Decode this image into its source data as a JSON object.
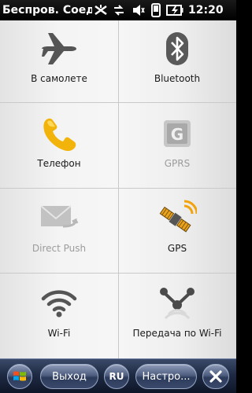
{
  "status_bar": {
    "title": "Беспров. Соедине",
    "time": "12:20"
  },
  "tiles": [
    {
      "label": "В самолете",
      "icon": "airplane-icon",
      "enabled": true
    },
    {
      "label": "Bluetooth",
      "icon": "bluetooth-icon",
      "enabled": true
    },
    {
      "label": "Телефон",
      "icon": "phone-icon",
      "enabled": true
    },
    {
      "label": "GPRS",
      "icon": "gprs-icon",
      "enabled": false
    },
    {
      "label": "Direct Push",
      "icon": "mail-icon",
      "enabled": false
    },
    {
      "label": "GPS",
      "icon": "satellite-icon",
      "enabled": true
    },
    {
      "label": "Wi-Fi",
      "icon": "wifi-icon",
      "enabled": true
    },
    {
      "label": "Передача по Wi-Fi",
      "icon": "wifi-sharing-icon",
      "enabled": true
    }
  ],
  "taskbar": {
    "exit_label": "Выход",
    "lang_label": "RU",
    "settings_label": "Настро..."
  },
  "colors": {
    "phone_accent": "#f2b40a",
    "gps_accent": "#f2a20c",
    "icon_dark": "#555555",
    "icon_disabled": "#b5b5b5"
  }
}
